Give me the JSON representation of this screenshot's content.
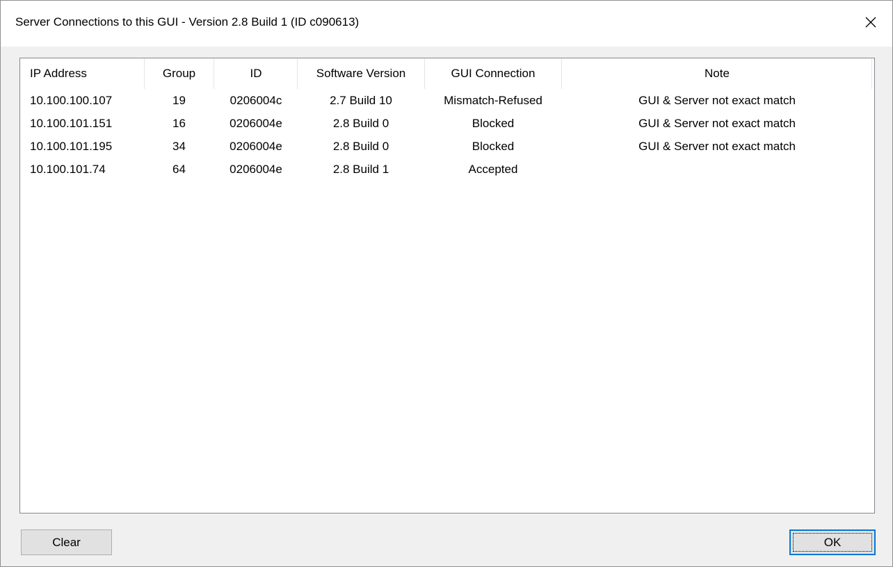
{
  "window": {
    "title": "Server Connections to this GUI - Version 2.8 Build 1   (ID c090613)",
    "close_icon": "close-icon"
  },
  "table": {
    "columns": [
      "IP Address",
      "Group",
      "ID",
      "Software Version",
      "GUI Connection",
      "Note"
    ],
    "rows": [
      {
        "ip": "10.100.100.107",
        "group": "19",
        "id": "0206004c",
        "version": "2.7 Build 10",
        "connection": "Mismatch-Refused",
        "note": "GUI & Server not exact match"
      },
      {
        "ip": "10.100.101.151",
        "group": "16",
        "id": "0206004e",
        "version": "2.8 Build 0",
        "connection": "Blocked",
        "note": "GUI & Server not exact match"
      },
      {
        "ip": "10.100.101.195",
        "group": "34",
        "id": "0206004e",
        "version": "2.8 Build 0",
        "connection": "Blocked",
        "note": "GUI & Server not exact match"
      },
      {
        "ip": "10.100.101.74",
        "group": "64",
        "id": "0206004e",
        "version": "2.8 Build 1",
        "connection": "Accepted",
        "note": ""
      }
    ]
  },
  "buttons": {
    "clear_label": "Clear",
    "ok_label": "OK"
  },
  "colors": {
    "focus_border": "#0078d7",
    "dialog_bg": "#f0f0f0"
  }
}
